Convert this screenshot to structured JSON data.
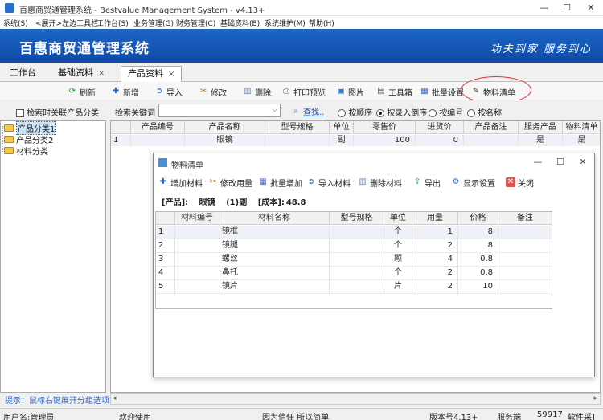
{
  "window": {
    "title": "百惠商贸通管理系统 - Bestvalue Management System - v4.13+",
    "controls": [
      "—",
      "☐",
      "✕"
    ]
  },
  "menu": [
    "系统(S)",
    "<展开>左边工具栏",
    "工作台(S)",
    "业务管理(G)",
    "财务管理(C)",
    "基础资料(B)",
    "系统维护(M)",
    "帮助(H)"
  ],
  "banner": {
    "title": "百惠商贸通管理系统",
    "slogan": "功夫到家 服务到心"
  },
  "tabs": [
    {
      "label": "工作台"
    },
    {
      "label": "基础资料",
      "close": "×"
    },
    {
      "label": "产品资料",
      "close": "×"
    }
  ],
  "toolbar": [
    "刷新",
    "新增",
    "导入",
    "修改",
    "删除",
    "打印预览",
    "图片",
    "工具箱",
    "批量设置",
    "物料清单"
  ],
  "filter": {
    "checkbox_label": "检索时关联产品分类",
    "search_label": "检索关键词",
    "search_value": "",
    "find_button": "查找..",
    "radios": [
      {
        "label": "按顺序",
        "checked": false
      },
      {
        "label": "按录入倒序",
        "checked": true
      },
      {
        "label": "按编号",
        "checked": false
      },
      {
        "label": "按名称",
        "checked": false
      }
    ]
  },
  "tree": [
    "产品分类1",
    "产品分类2",
    "材料分类"
  ],
  "hint": "提示：鼠标右键展开分组选项",
  "grid": {
    "headers": [
      "",
      "产品编号",
      "产品名称",
      "型号规格",
      "单位",
      "零售价",
      "进货价",
      "产品备注",
      "服务产品",
      "物料清单"
    ],
    "rows": [
      [
        "1",
        "",
        "眼镜",
        "",
        "副",
        "100",
        "0",
        "",
        "是",
        "是"
      ]
    ]
  },
  "dialog": {
    "title": "物料清单",
    "controls": [
      "—",
      "☐",
      "✕"
    ],
    "toolbar": [
      "增加材料",
      "修改用量",
      "批量增加",
      "导入材料",
      "删除材料",
      "导出",
      "显示设置",
      "关闭"
    ],
    "info": {
      "product": "[产品]:",
      "product_name": "眼镜",
      "qty": "(1)副",
      "cost_label": "[成本]:",
      "cost": "48.8"
    },
    "headers": [
      "",
      "材料编号",
      "材料名称",
      "型号规格",
      "单位",
      "用量",
      "价格",
      "备注"
    ],
    "rows": [
      [
        "1",
        "",
        "镜框",
        "",
        "个",
        "1",
        "8",
        ""
      ],
      [
        "2",
        "",
        "镜腿",
        "",
        "个",
        "2",
        "8",
        ""
      ],
      [
        "3",
        "",
        "螺丝",
        "",
        "颗",
        "4",
        "0.8",
        ""
      ],
      [
        "4",
        "",
        "鼻托",
        "",
        "个",
        "2",
        "0.8",
        ""
      ],
      [
        "5",
        "",
        "镜片",
        "",
        "片",
        "2",
        "10",
        ""
      ]
    ]
  },
  "status": [
    "用户名:管理员",
    "欢迎使用",
    "因为信任 所以简单",
    "版本号4.13+",
    "服务端",
    "59917",
    "软件采]"
  ]
}
